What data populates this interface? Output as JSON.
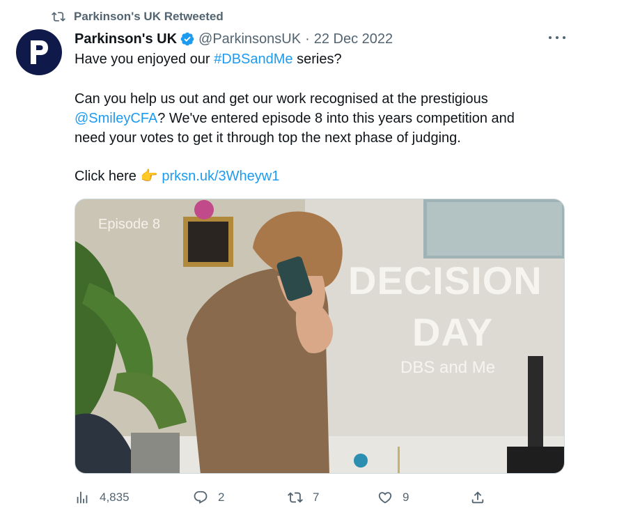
{
  "retweet_banner": {
    "icon": "retweet-icon",
    "label": "Parkinson's UK Retweeted"
  },
  "author": {
    "name": "Parkinson's UK",
    "handle": "@ParkinsonsUK",
    "separator": "·",
    "date": "22 Dec 2022",
    "avatar_letter": "P",
    "verified_color": "#1d9bf0"
  },
  "tweet": {
    "line1_pre": "Have you enjoyed our ",
    "line1_hashtag": "#DBSandMe",
    "line1_post": " series?",
    "line2": "Can you help us out and get our work recognised at the prestigious",
    "line3_mention": "@SmileyCFA",
    "line3_post": "? We've entered episode 8 into this years competition and",
    "line4": "need your votes to get it through top the next phase of judging.",
    "line5_pre": "Click here ",
    "line5_emoji": "👉",
    "line5_link": "prksn.uk/3Wheyw1"
  },
  "media": {
    "episode": "Episode 8",
    "title_line1": "DECISION",
    "title_line2": "DAY",
    "subtitle": "DBS and Me"
  },
  "actions": {
    "views": "4,835",
    "replies": "2",
    "retweets": "7",
    "likes": "9"
  },
  "colors": {
    "link": "#1d9bf0",
    "muted": "#536471",
    "text": "#0f1419"
  }
}
